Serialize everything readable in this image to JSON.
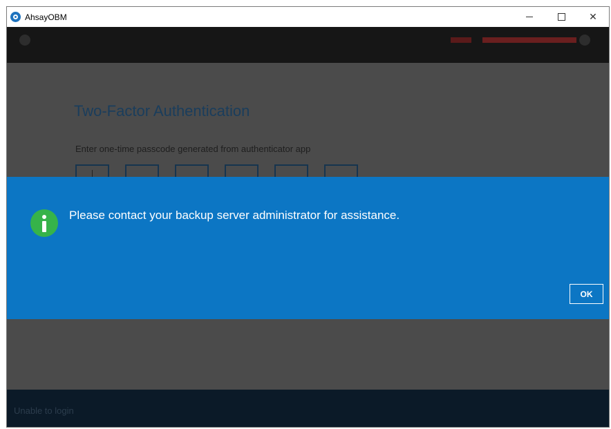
{
  "window": {
    "title": "AhsayOBM",
    "minimize_icon": "minimize-icon",
    "maximize_icon": "maximize-icon",
    "close_glyph": "✕"
  },
  "twofa": {
    "title": "Two-Factor Authentication",
    "instruction": "Enter one-time passcode generated from authenticator app",
    "code_fields_count": 6
  },
  "dialog": {
    "icon": "info-icon",
    "message": "Please contact your backup server administrator for assistance.",
    "ok_label": "OK",
    "background": "#0c76c4",
    "icon_color": "#36b34a"
  },
  "status": {
    "text": "Unable to login"
  }
}
